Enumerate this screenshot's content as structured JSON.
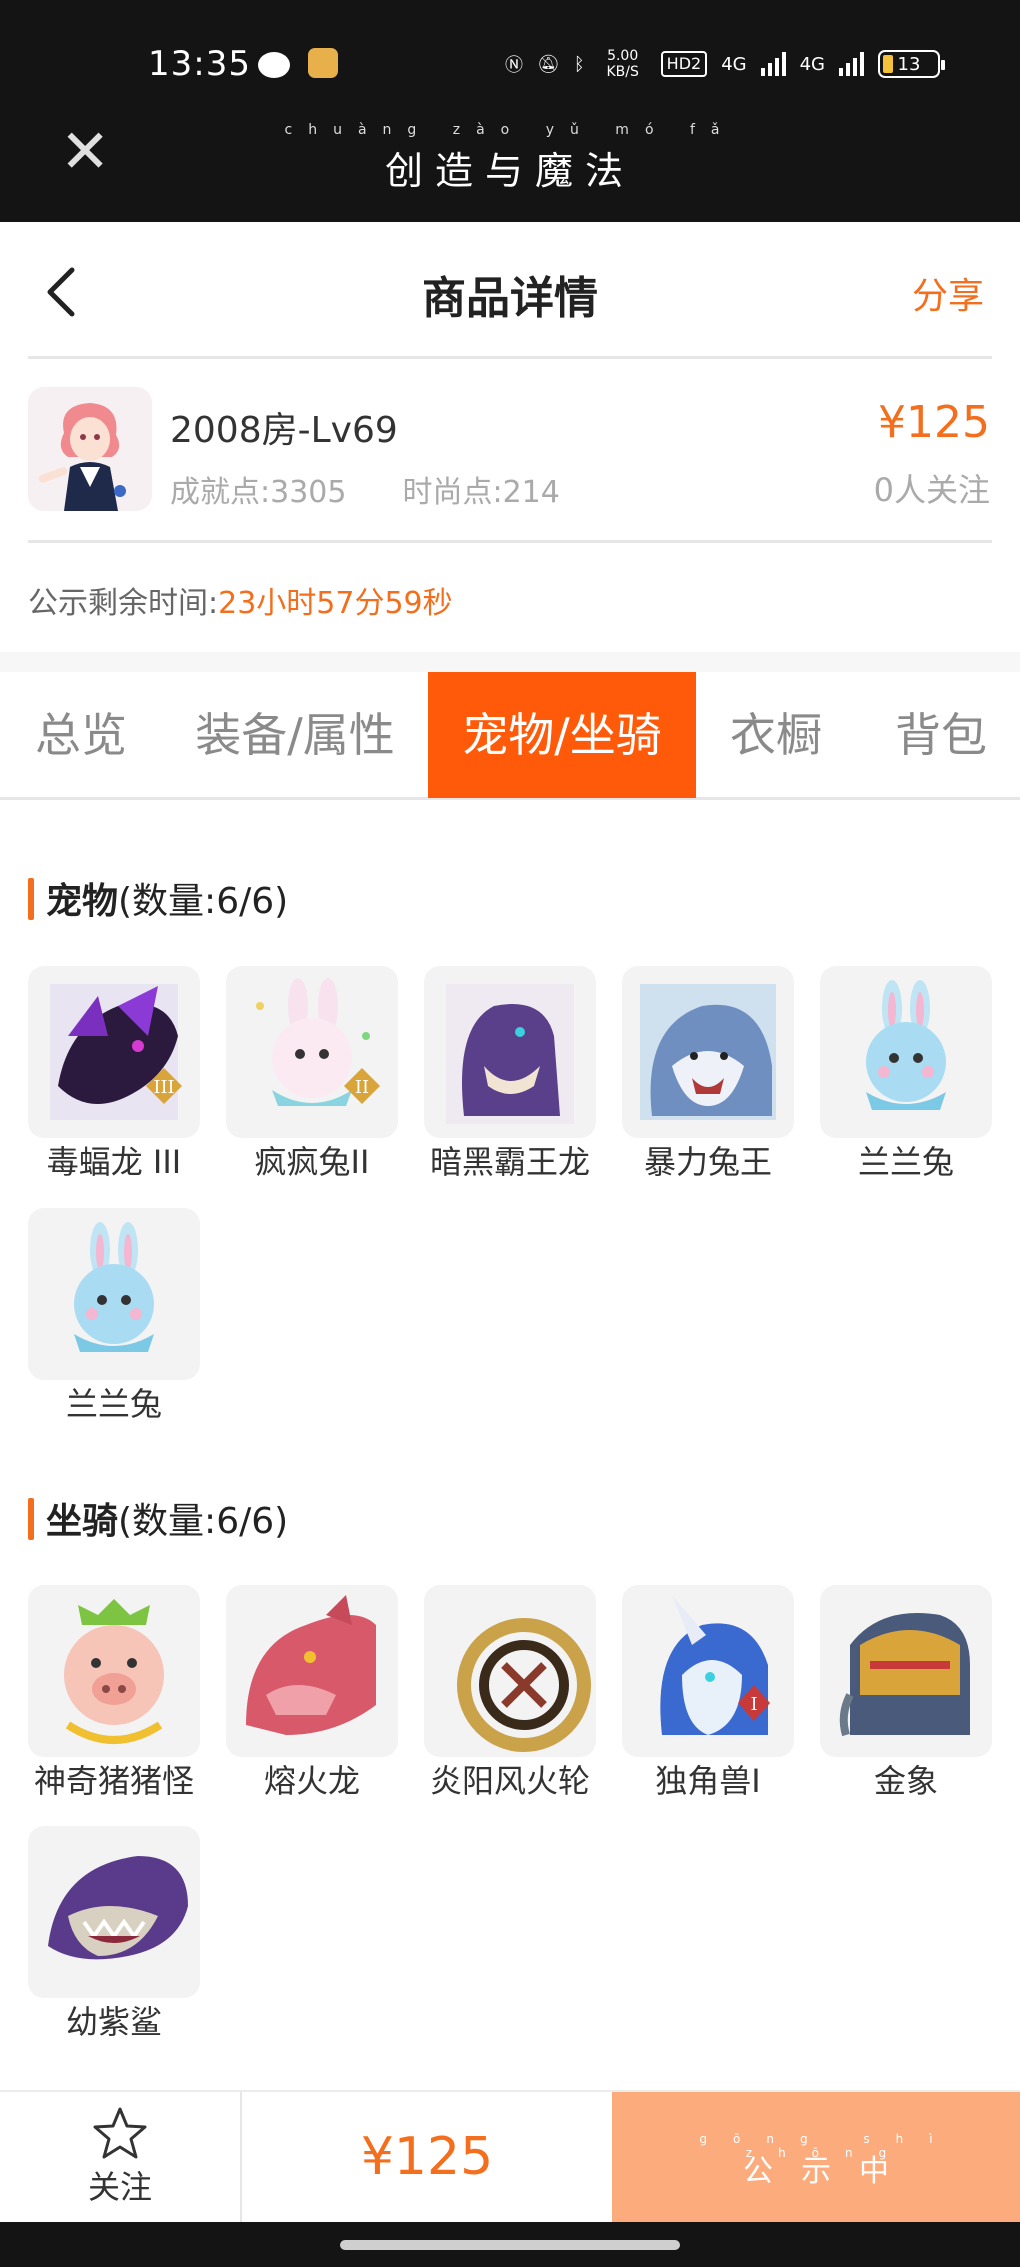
{
  "status_bar": {
    "time": "13:35",
    "net_speed": "5.00 KB/S",
    "hd": "HD2",
    "sim1": "4G",
    "sim2": "4G",
    "battery": "13",
    "icons": [
      "wechat-icon",
      "app-notify-icon",
      "nfc-icon",
      "mute-icon",
      "bluetooth-icon",
      "signal-icon",
      "battery-icon"
    ]
  },
  "app_bar": {
    "title": "创造与魔法",
    "title_pinyin": "chuàng zào yǔ mó fǎ"
  },
  "header": {
    "title": "商品详情",
    "share": "分享"
  },
  "product": {
    "name": "2008房-Lv69",
    "achievement": "成就点:3305",
    "fashion": "时尚点:214",
    "price": "¥125",
    "followers": "0人关注",
    "countdown_label": "公示剩余时间:",
    "countdown_value": "23小时57分59秒"
  },
  "tabs": [
    {
      "label": "总览",
      "active": false
    },
    {
      "label": "装备/属性",
      "active": false
    },
    {
      "label": "宠物/坐骑",
      "active": true
    },
    {
      "label": "衣橱",
      "active": false
    },
    {
      "label": "背包",
      "active": false
    }
  ],
  "pets": {
    "title": "宠物",
    "count_label": "(数量:6/6)",
    "items": [
      {
        "name": "毒蝠龙 III",
        "badge": "III"
      },
      {
        "name": "疯疯兔II",
        "badge": "II"
      },
      {
        "name": "暗黑霸王龙"
      },
      {
        "name": "暴力兔王"
      },
      {
        "name": "兰兰兔"
      },
      {
        "name": "兰兰兔"
      }
    ]
  },
  "mounts": {
    "title": "坐骑",
    "count_label": "(数量:6/6)",
    "items": [
      {
        "name": "神奇猪猪怪"
      },
      {
        "name": "熔火龙"
      },
      {
        "name": "炎阳风火轮"
      },
      {
        "name": "独角兽I",
        "badge": "I"
      },
      {
        "name": "金象"
      },
      {
        "name": "幼紫鲨"
      }
    ]
  },
  "bottom_bar": {
    "follow": "关注",
    "price": "¥125",
    "action": "公示中",
    "action_pinyin": "gōng shì zhōng"
  },
  "colors": {
    "accent": "#f36f1d",
    "tab_active": "#ff5a0a",
    "action_button": "#fcab7c",
    "status_bar": "#141414"
  }
}
